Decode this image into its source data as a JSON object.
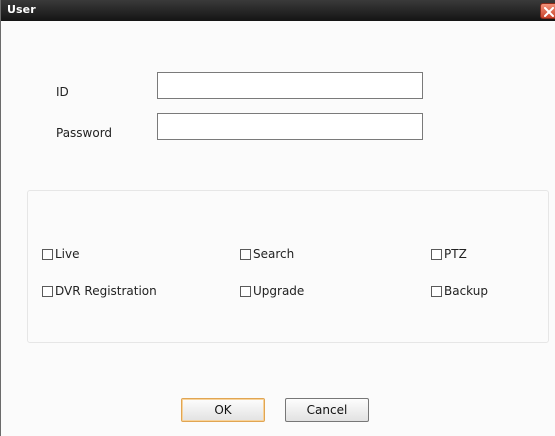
{
  "window": {
    "title": "User"
  },
  "fields": {
    "id_label": "ID",
    "id_value": "",
    "password_label": "Password",
    "password_value": ""
  },
  "permissions": [
    {
      "label": "Live",
      "checked": false
    },
    {
      "label": "Search",
      "checked": false
    },
    {
      "label": "PTZ",
      "checked": false
    },
    {
      "label": "DVR Registration",
      "checked": false
    },
    {
      "label": "Upgrade",
      "checked": false
    },
    {
      "label": "Backup",
      "checked": false
    }
  ],
  "buttons": {
    "ok": "OK",
    "cancel": "Cancel"
  },
  "colors": {
    "titlebar": "#1f1f1f",
    "close_button": "#d9533b",
    "default_button_border": "#e1a552"
  },
  "icons": {
    "close": "close-icon"
  }
}
